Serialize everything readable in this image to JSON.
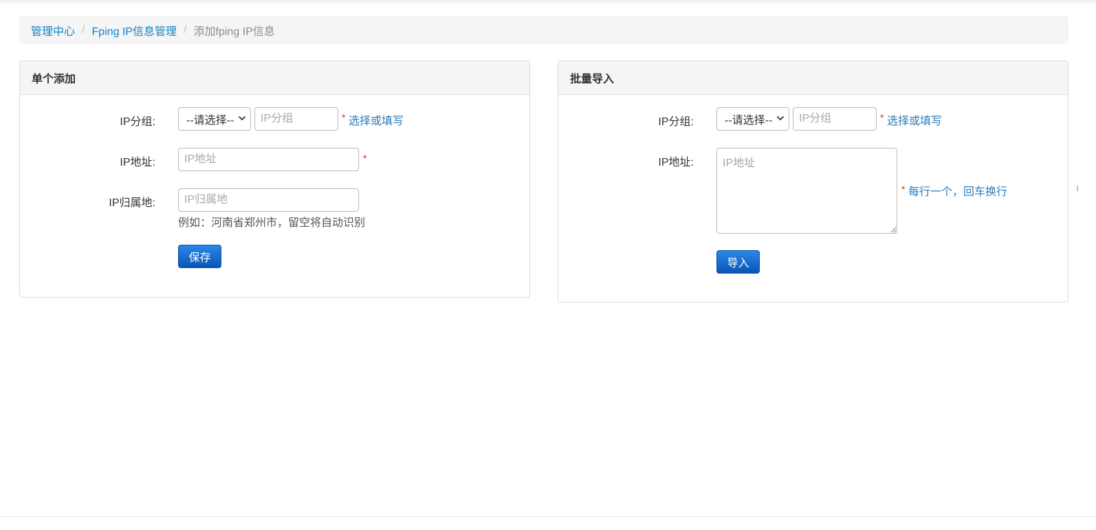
{
  "breadcrumb": {
    "items": [
      "管理中心",
      "Fping IP信息管理"
    ],
    "current": "添加fping IP信息",
    "separator": "/"
  },
  "single": {
    "title": "单个添加",
    "group_label": "IP分组:",
    "group_select": "--请选择--",
    "group_placeholder": "IP分组",
    "group_hint": "选择或填写",
    "ip_label": "IP地址:",
    "ip_placeholder": "IP地址",
    "location_label": "IP归属地:",
    "location_placeholder": "IP归属地",
    "location_help": "例如：河南省郑州市，留空将自动识别",
    "save_label": "保存",
    "required_mark": "*"
  },
  "batch": {
    "title": "批量导入",
    "group_label": "IP分组:",
    "group_select": "--请选择--",
    "group_placeholder": "IP分组",
    "group_hint": "选择或填写",
    "ip_label": "IP地址:",
    "ip_placeholder": "IP地址",
    "ip_hint": "每行一个，回车换行",
    "import_label": "导入",
    "required_mark": "*"
  },
  "colors": {
    "link": "#0f84c6",
    "hint": "#2b7bb9",
    "required": "#c9302c",
    "button": "#0a55b8"
  }
}
